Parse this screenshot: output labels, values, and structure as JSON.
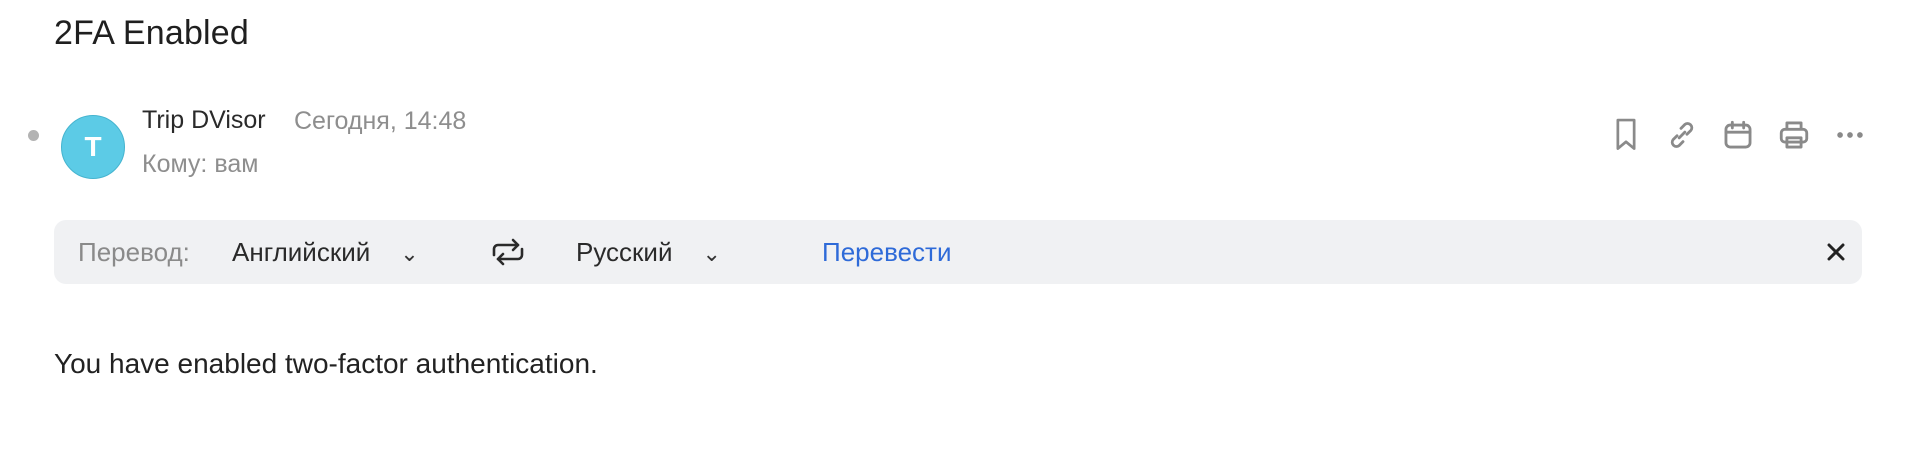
{
  "email": {
    "subject": "2FA Enabled",
    "sender_name": "Trip DVisor",
    "sender_initial": "T",
    "date": "Сегодня, 14:48",
    "recipient": "Кому: вам",
    "body": "You have enabled two-factor authentication."
  },
  "toolbar": {
    "icons": [
      "bookmark-icon",
      "link-icon",
      "calendar-icon",
      "print-icon",
      "more-icon"
    ]
  },
  "translation": {
    "label": "Перевод:",
    "from_language": "Английский",
    "to_language": "Русский",
    "translate_button": "Перевести"
  },
  "colors": {
    "avatar": "#5ccbe6",
    "link": "#2e6ad8",
    "bar_bg": "#f0f1f3"
  }
}
